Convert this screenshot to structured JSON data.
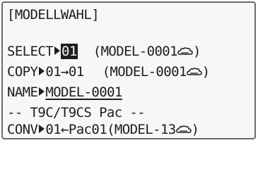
{
  "title": "[MODELLWAHL]",
  "select": {
    "label": "SELECT",
    "value": "01",
    "model": "(MODEL-0001",
    "icon": "cloud-icon",
    "close": ")"
  },
  "copy": {
    "label": "COPY",
    "value": "01→01",
    "model": "(MODEL-0001",
    "icon": "cloud-icon",
    "close": ")"
  },
  "name": {
    "label": "NAME",
    "value": "MODEL-0001"
  },
  "section": {
    "text": "-- T9C/T9CS Pac --"
  },
  "conv": {
    "label": "CONV",
    "value": "01←Pac01",
    "model": "(MODEL-13",
    "icon": "cloud-icon",
    "close": ")"
  }
}
